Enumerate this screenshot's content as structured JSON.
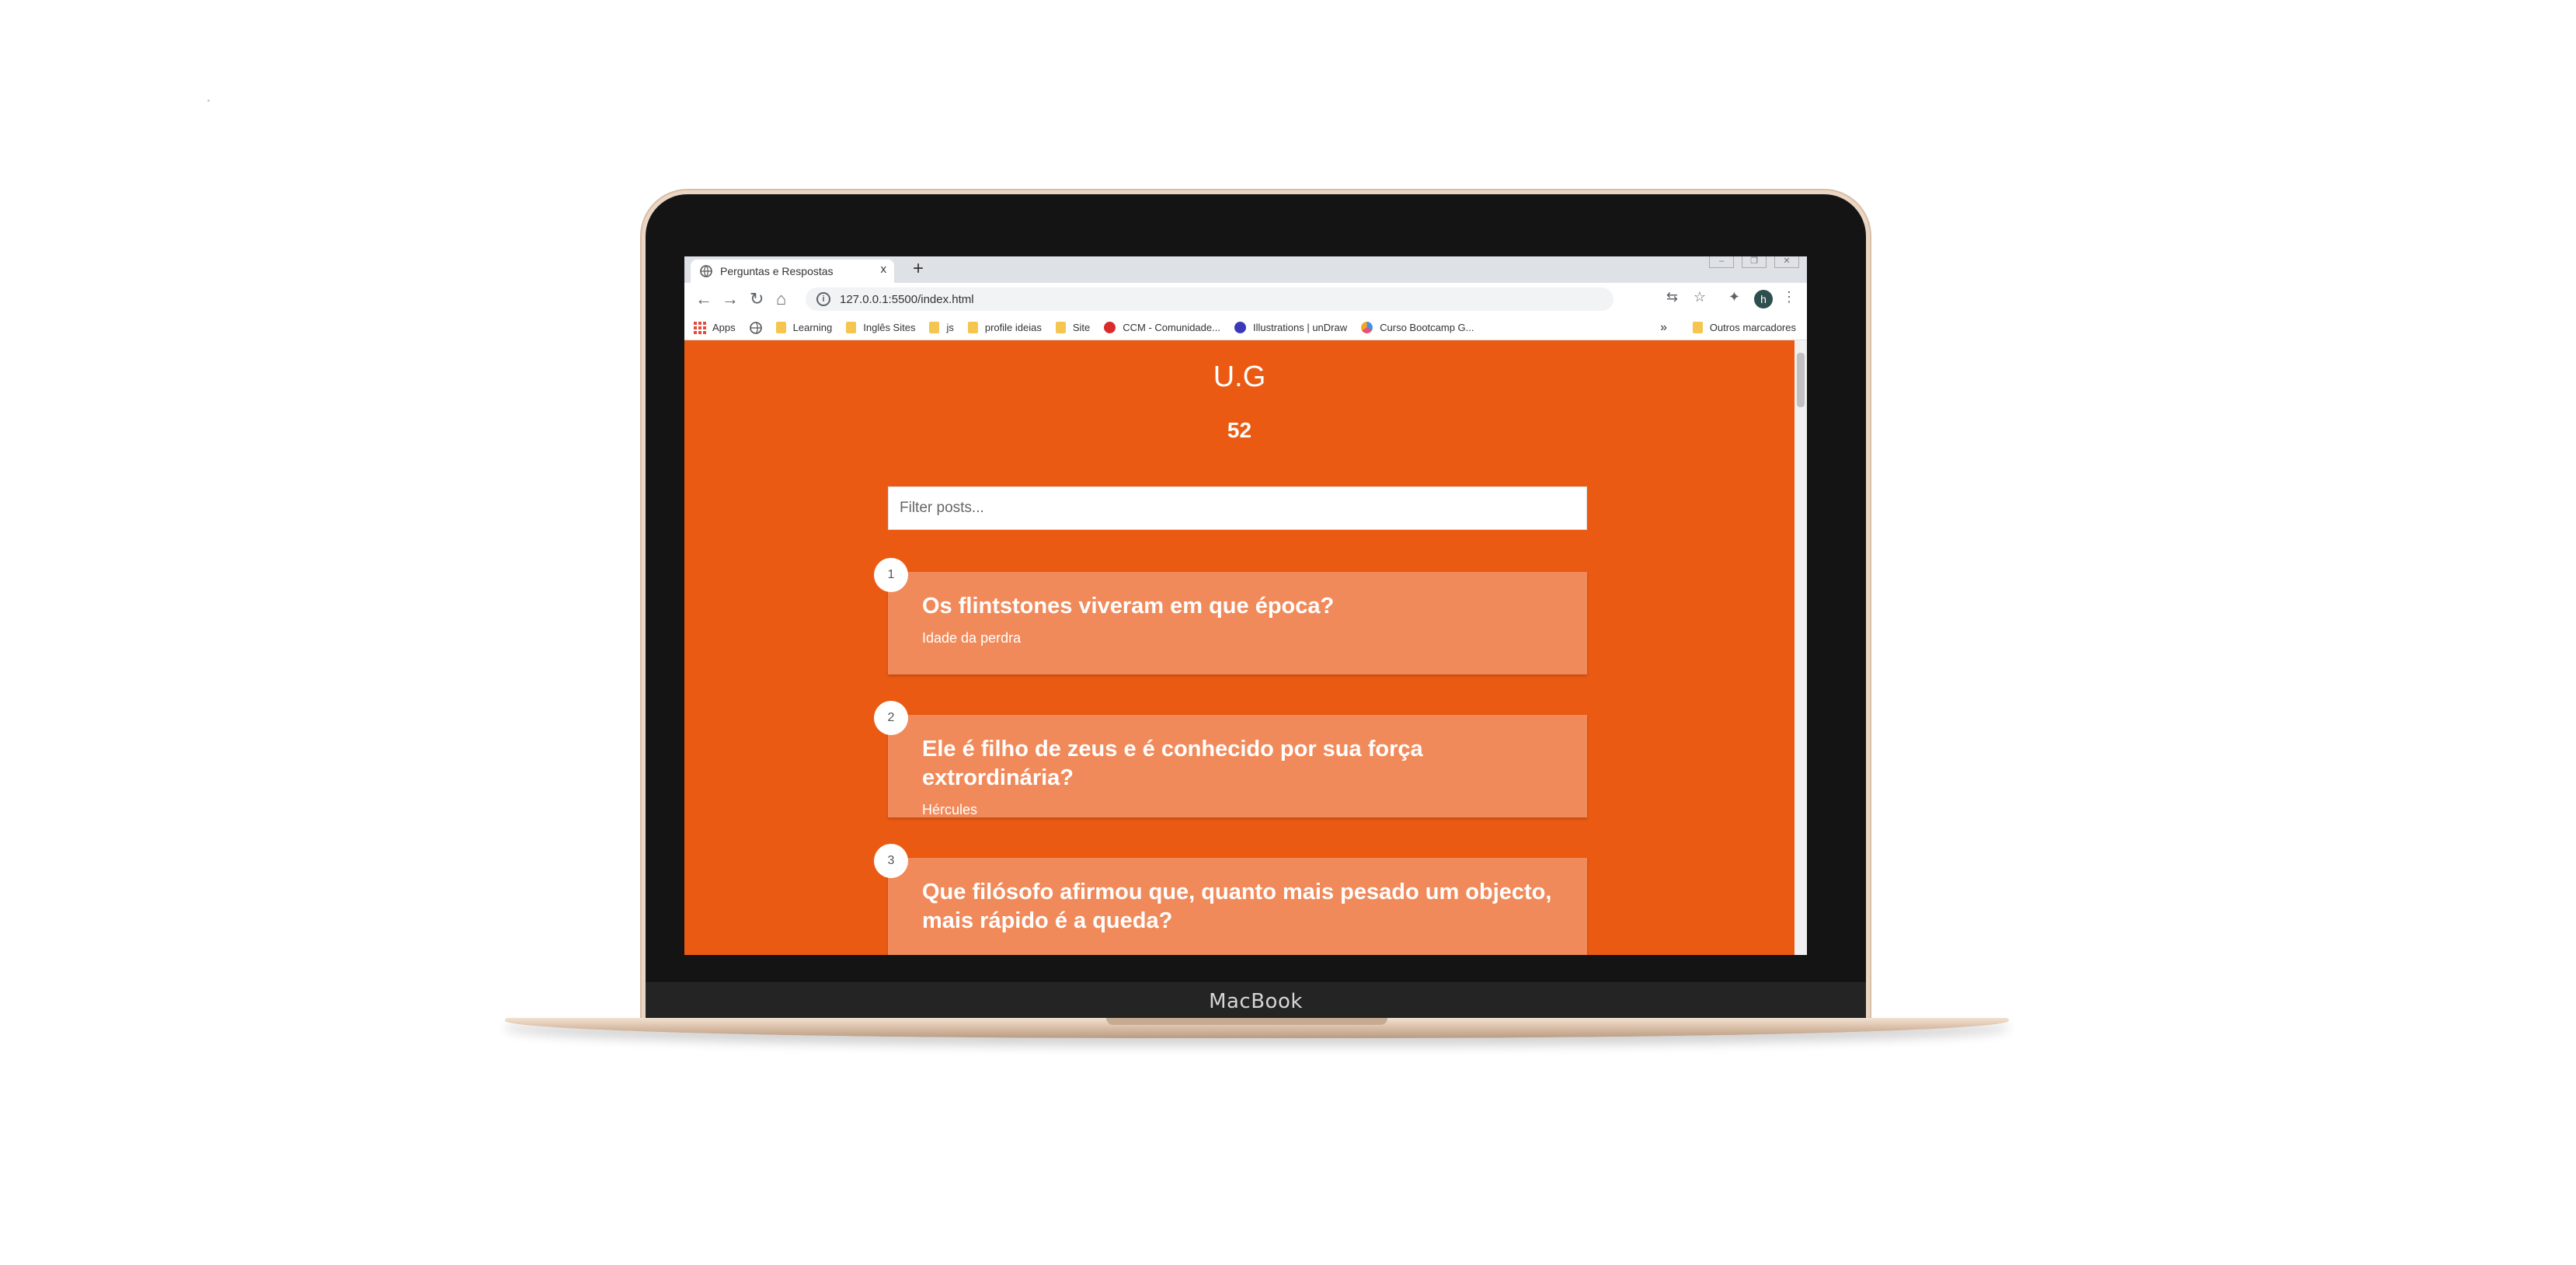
{
  "device": {
    "brand": "MacBook"
  },
  "browser": {
    "tab_title": "Perguntas e Respostas",
    "tab_close": "x",
    "new_tab": "+",
    "url": "127.0.0.1:5500/index.html",
    "bookmarks": [
      {
        "label": "Apps",
        "icon": "apps-grid-icon"
      },
      {
        "label": "",
        "icon": "globe-icon"
      },
      {
        "label": "Learning",
        "icon": "folder-icon"
      },
      {
        "label": "Inglês Sites",
        "icon": "folder-icon"
      },
      {
        "label": "js",
        "icon": "folder-icon"
      },
      {
        "label": "profile ideias",
        "icon": "folder-icon"
      },
      {
        "label": "Site",
        "icon": "folder-icon"
      },
      {
        "label": "CCM - Comunidade...",
        "icon": "ccm-icon"
      },
      {
        "label": "Illustrations | unDraw",
        "icon": "undraw-icon"
      },
      {
        "label": "Curso Bootcamp G...",
        "icon": "bootcamp-icon"
      }
    ],
    "bookmarks_more": "»",
    "other_bookmarks": "Outros marcadores",
    "profile_initial": "h"
  },
  "page": {
    "logo": "U.G",
    "count": "52",
    "filter_placeholder": "Filter posts...",
    "posts": [
      {
        "number": "1",
        "title": "Os flintstones viveram em que época?",
        "body": "Idade da perdra"
      },
      {
        "number": "2",
        "title": "Ele é filho de zeus e é conhecido por sua força extrordinária?",
        "body": "Hércules"
      },
      {
        "number": "3",
        "title": "Que filósofo afirmou que, quanto mais pesado um objecto, mais rápido é a queda?",
        "body": ""
      }
    ]
  },
  "colors": {
    "page_bg": "#eb5a13",
    "card_bg": "#f18a5a",
    "text": "#ffffff"
  }
}
